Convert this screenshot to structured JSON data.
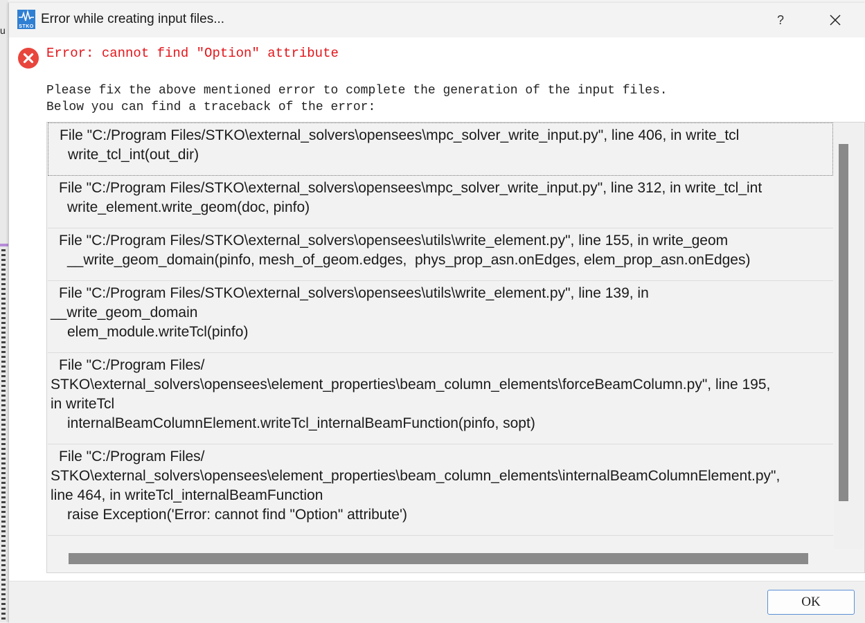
{
  "window": {
    "title": "Error while creating input files...",
    "logo_text": "STKO",
    "help_label": "?"
  },
  "background": {
    "edge_text": "u"
  },
  "error": {
    "title": "Error: cannot find \"Option\" attribute",
    "message_line1": "Please fix the above mentioned error to complete the generation of the input files.",
    "message_line2": "Below you can find a traceback of the error:"
  },
  "traceback": [
    {
      "file_line": "File \"C:/Program Files/STKO\\external_solvers\\opensees\\mpc_solver_write_input.py\", line 406, in write_tcl",
      "code": "write_tcl_int(out_dir)"
    },
    {
      "file_line": "File \"C:/Program Files/STKO\\external_solvers\\opensees\\mpc_solver_write_input.py\", line 312, in write_tcl_int",
      "code": "write_element.write_geom(doc, pinfo)"
    },
    {
      "file_line": "File \"C:/Program Files/STKO\\external_solvers\\opensees\\utils\\write_element.py\", line 155, in write_geom",
      "code": "__write_geom_domain(pinfo, mesh_of_geom.edges,  phys_prop_asn.onEdges, elem_prop_asn.onEdges)"
    },
    {
      "file_line": "File \"C:/Program Files/STKO\\external_solvers\\opensees\\utils\\write_element.py\", line 139, in",
      "file_line_cont": "__write_geom_domain",
      "code": "elem_module.writeTcl(pinfo)"
    },
    {
      "file_line": "File \"C:/Program Files/",
      "file_line_cont": "STKO\\external_solvers\\opensees\\element_properties\\beam_column_elements\\forceBeamColumn.py\", line 195,",
      "file_line_cont2": "in writeTcl",
      "code": "internalBeamColumnElement.writeTcl_internalBeamFunction(pinfo, sopt)"
    },
    {
      "file_line": "File \"C:/Program Files/",
      "file_line_cont": "STKO\\external_solvers\\opensees\\element_properties\\beam_column_elements\\internalBeamColumnElement.py\",",
      "file_line_cont2": "line 464, in writeTcl_internalBeamFunction",
      "code": "raise Exception('Error: cannot find \"Option\" attribute')"
    }
  ],
  "footer": {
    "ok_label": "OK"
  },
  "colors": {
    "error_red": "#e3161b",
    "accent_blue": "#5a8fd6",
    "logo_blue": "#2f7fd3"
  }
}
